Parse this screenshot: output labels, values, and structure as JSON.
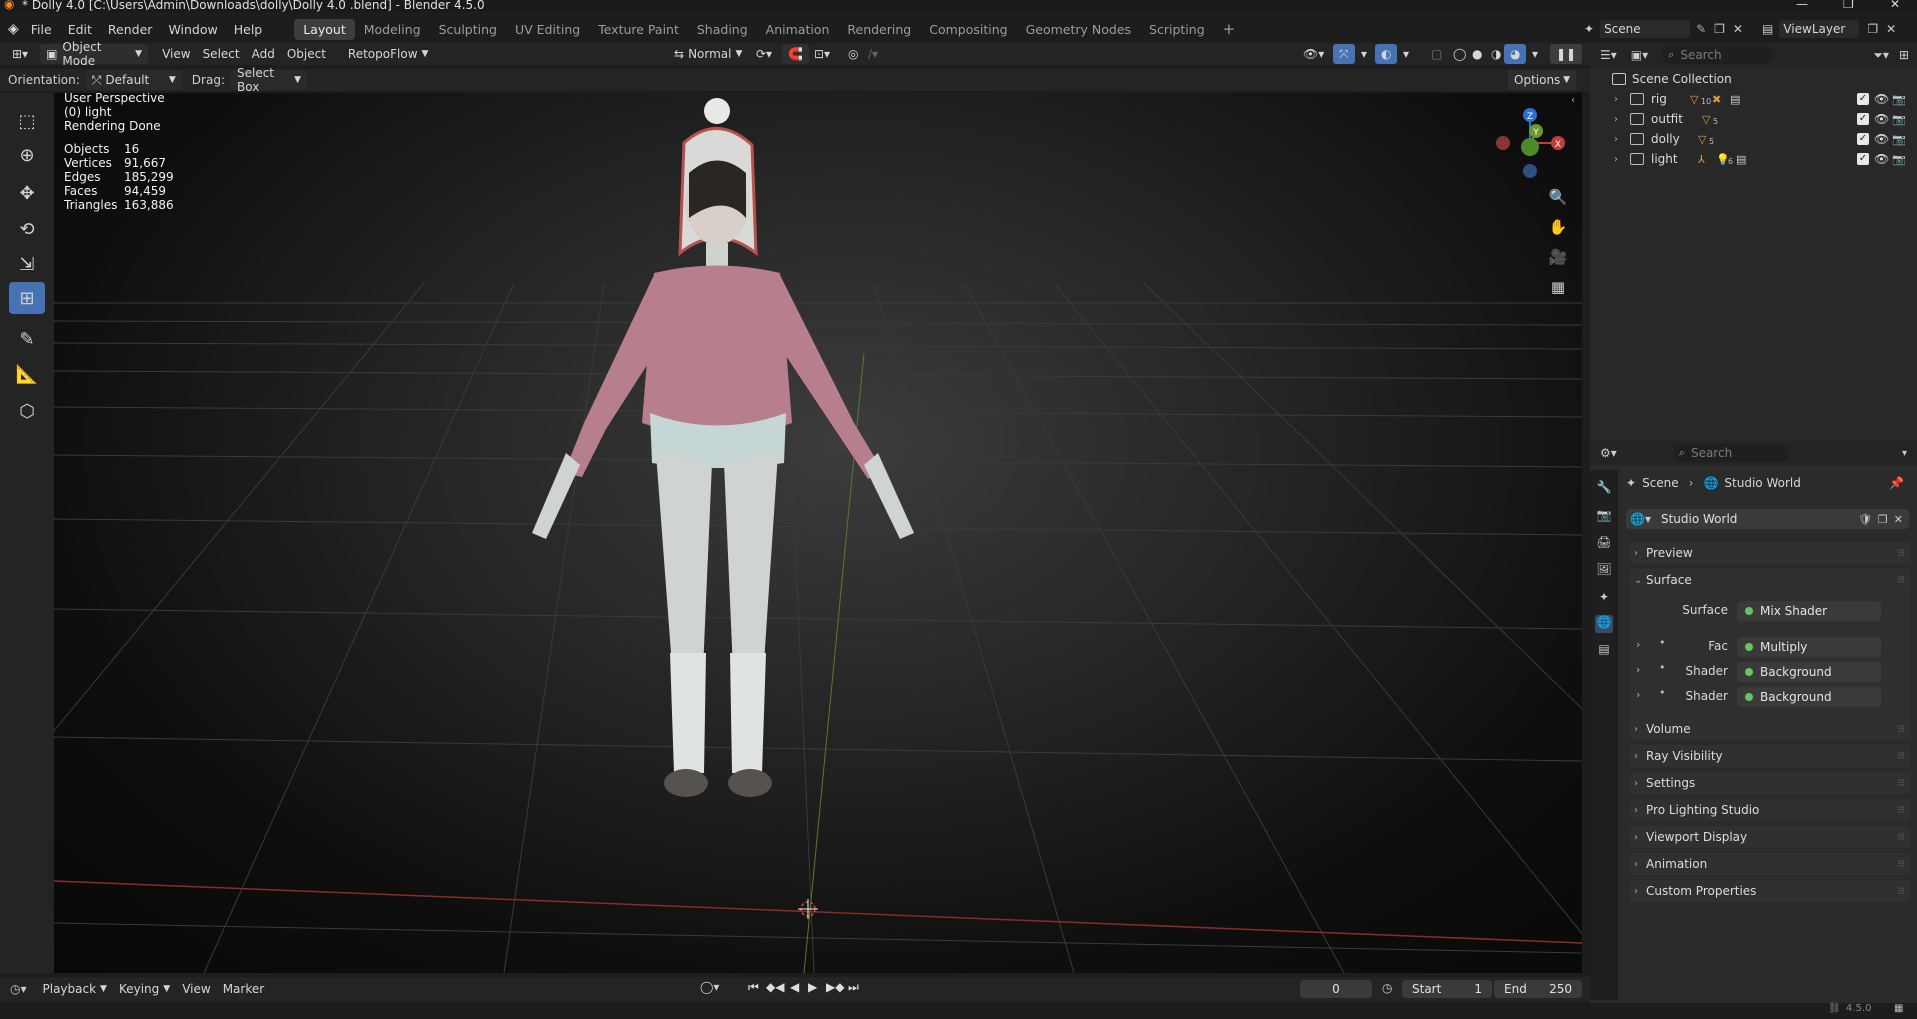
{
  "window": {
    "title": "* Dolly 4.0  [C:\\Users\\Admin\\Downloads\\dolly\\Dolly 4.0 .blend] - Blender 4.5.0"
  },
  "menu": [
    "File",
    "Edit",
    "Render",
    "Window",
    "Help"
  ],
  "workspaces": [
    "Layout",
    "Modeling",
    "Sculpting",
    "UV Editing",
    "Texture Paint",
    "Shading",
    "Animation",
    "Rendering",
    "Compositing",
    "Geometry Nodes",
    "Scripting"
  ],
  "active_workspace": "Layout",
  "scene": {
    "name": "Scene",
    "view_layer": "ViewLayer"
  },
  "header": {
    "mode": "Object Mode",
    "menus": [
      "View",
      "Select",
      "Add",
      "Object"
    ],
    "addon": "RetopoFlow",
    "transform_orientation": "Normal"
  },
  "toolhdr": {
    "orientation_label": "Orientation:",
    "orientation_value": "Default",
    "drag_label": "Drag:",
    "drag_value": "Select Box",
    "options": "Options"
  },
  "viewport": {
    "view_name": "User Perspective",
    "active_object": "(0) light",
    "render_status": "Rendering Done",
    "stats": [
      {
        "label": "Objects",
        "value": "16"
      },
      {
        "label": "Vertices",
        "value": "91,667"
      },
      {
        "label": "Edges",
        "value": "185,299"
      },
      {
        "label": "Faces",
        "value": "94,459"
      },
      {
        "label": "Triangles",
        "value": "163,886"
      }
    ],
    "gizmo_axes": [
      "Z",
      "Y",
      "X"
    ]
  },
  "outliner": {
    "search_placeholder": "Search",
    "root": "Scene Collection",
    "collections": [
      {
        "name": "rig",
        "badge": "10"
      },
      {
        "name": "outfit",
        "badge": "5"
      },
      {
        "name": "dolly",
        "badge": "5"
      },
      {
        "name": "light",
        "badge": "6"
      }
    ]
  },
  "properties": {
    "search_placeholder": "Search",
    "breadcrumb": [
      "Scene",
      "Studio World"
    ],
    "world_name": "Studio World",
    "panels": {
      "preview": "Preview",
      "surface": "Surface",
      "volume": "Volume",
      "ray_visibility": "Ray Visibility",
      "settings": "Settings",
      "pro_lighting": "Pro Lighting Studio",
      "viewport_display": "Viewport Display",
      "animation": "Animation",
      "custom_properties": "Custom Properties"
    },
    "surface_rows": [
      {
        "label": "Surface",
        "value": "Mix Shader"
      },
      {
        "label": "Fac",
        "value": "Multiply"
      },
      {
        "label": "Shader",
        "value": "Background"
      },
      {
        "label": "Shader",
        "value": "Background"
      }
    ]
  },
  "timeline": {
    "menus": [
      "Playback",
      "Keying",
      "View",
      "Marker"
    ],
    "current_frame": "0",
    "start_label": "Start",
    "start": "1",
    "end_label": "End",
    "end": "250"
  },
  "status": {
    "version": "4.5.0"
  }
}
